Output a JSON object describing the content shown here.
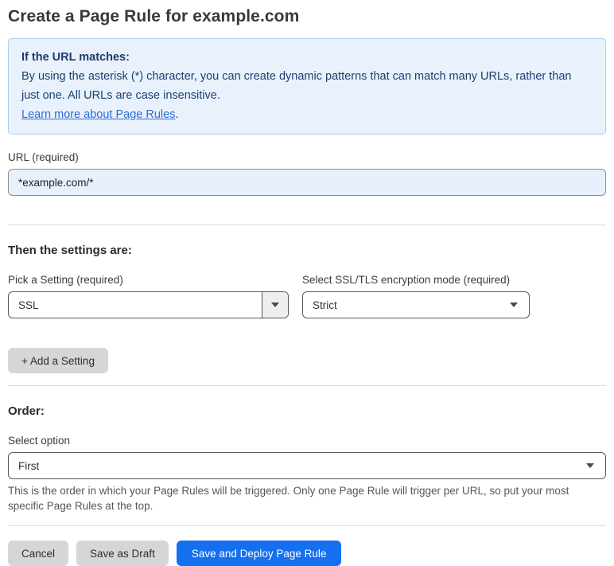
{
  "page": {
    "title": "Create a Page Rule for example.com"
  },
  "info_box": {
    "heading": "If the URL matches:",
    "body": "By using the asterisk (*) character, you can create dynamic patterns that can match many URLs, rather than just one. All URLs are case insensitive.",
    "link_label": "Learn more about Page Rules",
    "link_suffix": "."
  },
  "url_field": {
    "label": "URL (required)",
    "value": "*example.com/*"
  },
  "settings_section": {
    "heading": "Then the settings are:",
    "setting_picker": {
      "label": "Pick a Setting (required)",
      "value": "SSL"
    },
    "ssl_mode_picker": {
      "label": "Select SSL/TLS encryption mode (required)",
      "value": "Strict"
    },
    "add_setting_label": "+ Add a Setting"
  },
  "order_section": {
    "heading": "Order:",
    "select_label": "Select option",
    "value": "First",
    "help_text": "This is the order in which your Page Rules will be triggered. Only one Page Rule will trigger per URL, so put your most specific Page Rules at the top."
  },
  "footer": {
    "cancel_label": "Cancel",
    "save_draft_label": "Save as Draft",
    "save_deploy_label": "Save and Deploy Page Rule"
  },
  "colors": {
    "accent_blue": "#1570f0",
    "info_background": "#e9f2fc",
    "info_border": "#a9cdee",
    "info_text": "#1d3f72",
    "link_blue": "#2c6bd9",
    "input_background": "#e8f0fe",
    "button_gray": "#d6d6d6",
    "divider_gray": "#dcdcdc"
  },
  "icons": {
    "dropdown_arrow": "caret-down"
  }
}
